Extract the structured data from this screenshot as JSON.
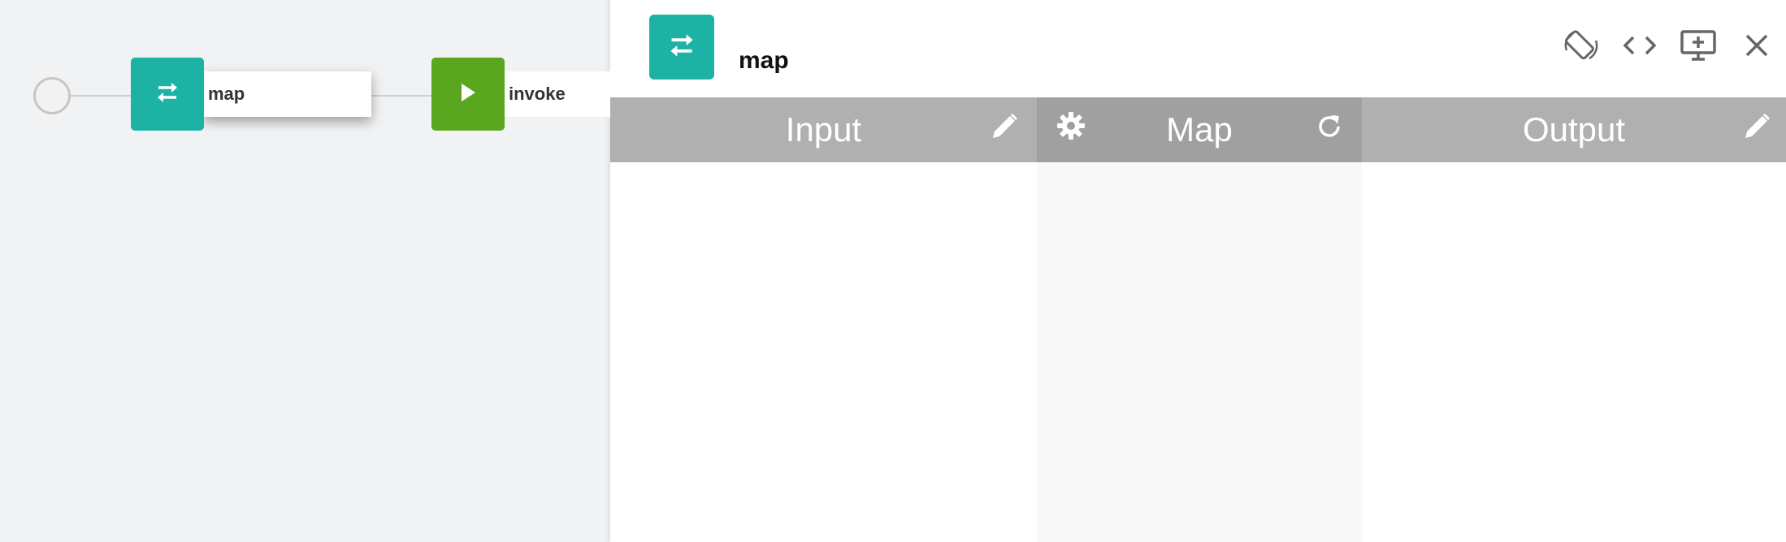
{
  "flow": {
    "nodes": [
      {
        "label": "map",
        "icon": "swap-arrows-icon",
        "color": "#1db3a4",
        "selected": true
      },
      {
        "label": "invoke",
        "icon": "play-icon",
        "color": "#5aa61f",
        "selected": false
      }
    ]
  },
  "panel": {
    "title": "map",
    "icon": "swap-arrows-icon",
    "icon_color": "#1db3a4",
    "actions": [
      "rotate-screen-icon",
      "code-icon",
      "add-display-icon",
      "close-icon"
    ],
    "columns": {
      "input": {
        "label": "Input",
        "action_icon": "pencil-icon"
      },
      "map": {
        "label": "Map",
        "left_icon": "gear-icon",
        "right_icon": "refresh-icon"
      },
      "output": {
        "label": "Output",
        "action_icon": "pencil-icon"
      }
    }
  },
  "colors": {
    "teal": "#1db3a4",
    "green": "#5aa61f",
    "header_gray": "#b0b0b0",
    "map_header_gray": "#a0a0a0",
    "canvas_bg": "#f0f2f4"
  }
}
